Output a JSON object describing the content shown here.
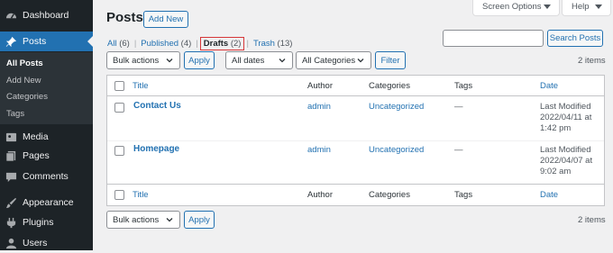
{
  "sidebar": {
    "items": [
      {
        "label": "Dashboard",
        "icon": "dashboard-icon"
      },
      {
        "label": "Posts",
        "icon": "pin-icon",
        "current": true
      },
      {
        "label": "Media",
        "icon": "media-icon"
      },
      {
        "label": "Pages",
        "icon": "pages-icon"
      },
      {
        "label": "Comments",
        "icon": "comments-icon"
      },
      {
        "label": "Appearance",
        "icon": "paintbrush-icon"
      },
      {
        "label": "Plugins",
        "icon": "plugin-icon"
      },
      {
        "label": "Users",
        "icon": "users-icon"
      }
    ],
    "submenu": [
      "All Posts",
      "Add New",
      "Categories",
      "Tags"
    ]
  },
  "header": {
    "title": "Posts",
    "add_new": "Add New",
    "screen_options": "Screen Options",
    "help": "Help"
  },
  "views": {
    "all": {
      "label": "All",
      "count": "(6)"
    },
    "published": {
      "label": "Published",
      "count": "(4)"
    },
    "drafts": {
      "label": "Drafts",
      "count": "(2)"
    },
    "trash": {
      "label": "Trash",
      "count": "(13)"
    },
    "separator": "|"
  },
  "search": {
    "value": "",
    "button": "Search Posts"
  },
  "filters": {
    "bulk_actions": "Bulk actions",
    "apply": "Apply",
    "dates": "All dates",
    "categories": "All Categories",
    "filter": "Filter",
    "items_count": "2 items"
  },
  "table": {
    "columns": {
      "title": "Title",
      "author": "Author",
      "categories": "Categories",
      "tags": "Tags",
      "date": "Date"
    },
    "rows": [
      {
        "title": "Contact Us",
        "author": "admin",
        "category": "Uncategorized",
        "tags": "—",
        "status": "Last Modified",
        "date": "2022/04/11 at",
        "time": "1:42 pm"
      },
      {
        "title": "Homepage",
        "author": "admin",
        "category": "Uncategorized",
        "tags": "—",
        "status": "Last Modified",
        "date": "2022/04/07 at",
        "time": "9:02 am"
      }
    ]
  },
  "footer": {
    "bulk_actions": "Bulk actions",
    "apply": "Apply",
    "items_count": "2 items"
  },
  "colors": {
    "sidebar": "#1d2327",
    "accent": "#2271b1",
    "highlight": "#d63638"
  }
}
